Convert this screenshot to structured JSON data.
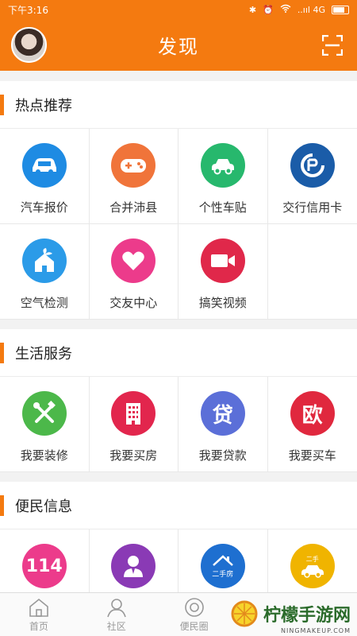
{
  "status_bar": {
    "time": "下午3:16",
    "network": "..ııl 4G"
  },
  "app_bar": {
    "title": "发现"
  },
  "sections": [
    {
      "title": "热点推荐",
      "items": [
        {
          "label": "汽车报价",
          "icon": "car-icon",
          "color": "#1e8be3"
        },
        {
          "label": "合并沛县",
          "icon": "gamepad-icon",
          "color": "#f0743a"
        },
        {
          "label": "个性车贴",
          "icon": "car-sticker-icon",
          "color": "#27b86d"
        },
        {
          "label": "交行信用卡",
          "icon": "bocom-logo-icon",
          "color": "#1a5ca8"
        },
        {
          "label": "空气检测",
          "icon": "house-leaf-icon",
          "color": "#2b9be8"
        },
        {
          "label": "交友中心",
          "icon": "heart-icon",
          "color": "#ec3b8b"
        },
        {
          "label": "搞笑视频",
          "icon": "video-camera-icon",
          "color": "#e0284a"
        }
      ]
    },
    {
      "title": "生活服务",
      "items": [
        {
          "label": "我要装修",
          "icon": "tools-icon",
          "color": "#4cb84a"
        },
        {
          "label": "我要买房",
          "icon": "building-icon",
          "color": "#e2264d",
          "glyph": ""
        },
        {
          "label": "我要贷款",
          "icon": "loan-icon",
          "color": "#5b6fd8",
          "glyph": "贷"
        },
        {
          "label": "我要买车",
          "icon": "buy-car-icon",
          "color": "#e0283e",
          "glyph": "欧"
        }
      ]
    },
    {
      "title": "便民信息",
      "items": [
        {
          "label": "",
          "icon": "phone-114-icon",
          "color": "#ec3b8b",
          "glyph": "114"
        },
        {
          "label": "",
          "icon": "person-icon",
          "color": "#8a3ab5"
        },
        {
          "label": "",
          "icon": "second-hand-house-icon",
          "color": "#1e6fd0",
          "glyph": "二手房"
        },
        {
          "label": "",
          "icon": "second-hand-car-icon",
          "color": "#f0b400",
          "glyph": "二手"
        }
      ]
    }
  ],
  "tab_bar": {
    "tabs": [
      {
        "label": "首页",
        "icon": "home-icon"
      },
      {
        "label": "社区",
        "icon": "community-icon"
      },
      {
        "label": "便民圈",
        "icon": "circle-icon"
      }
    ]
  },
  "watermark": {
    "text": "柠檬手游网",
    "sub": "NINGMAKEUP.COM"
  }
}
